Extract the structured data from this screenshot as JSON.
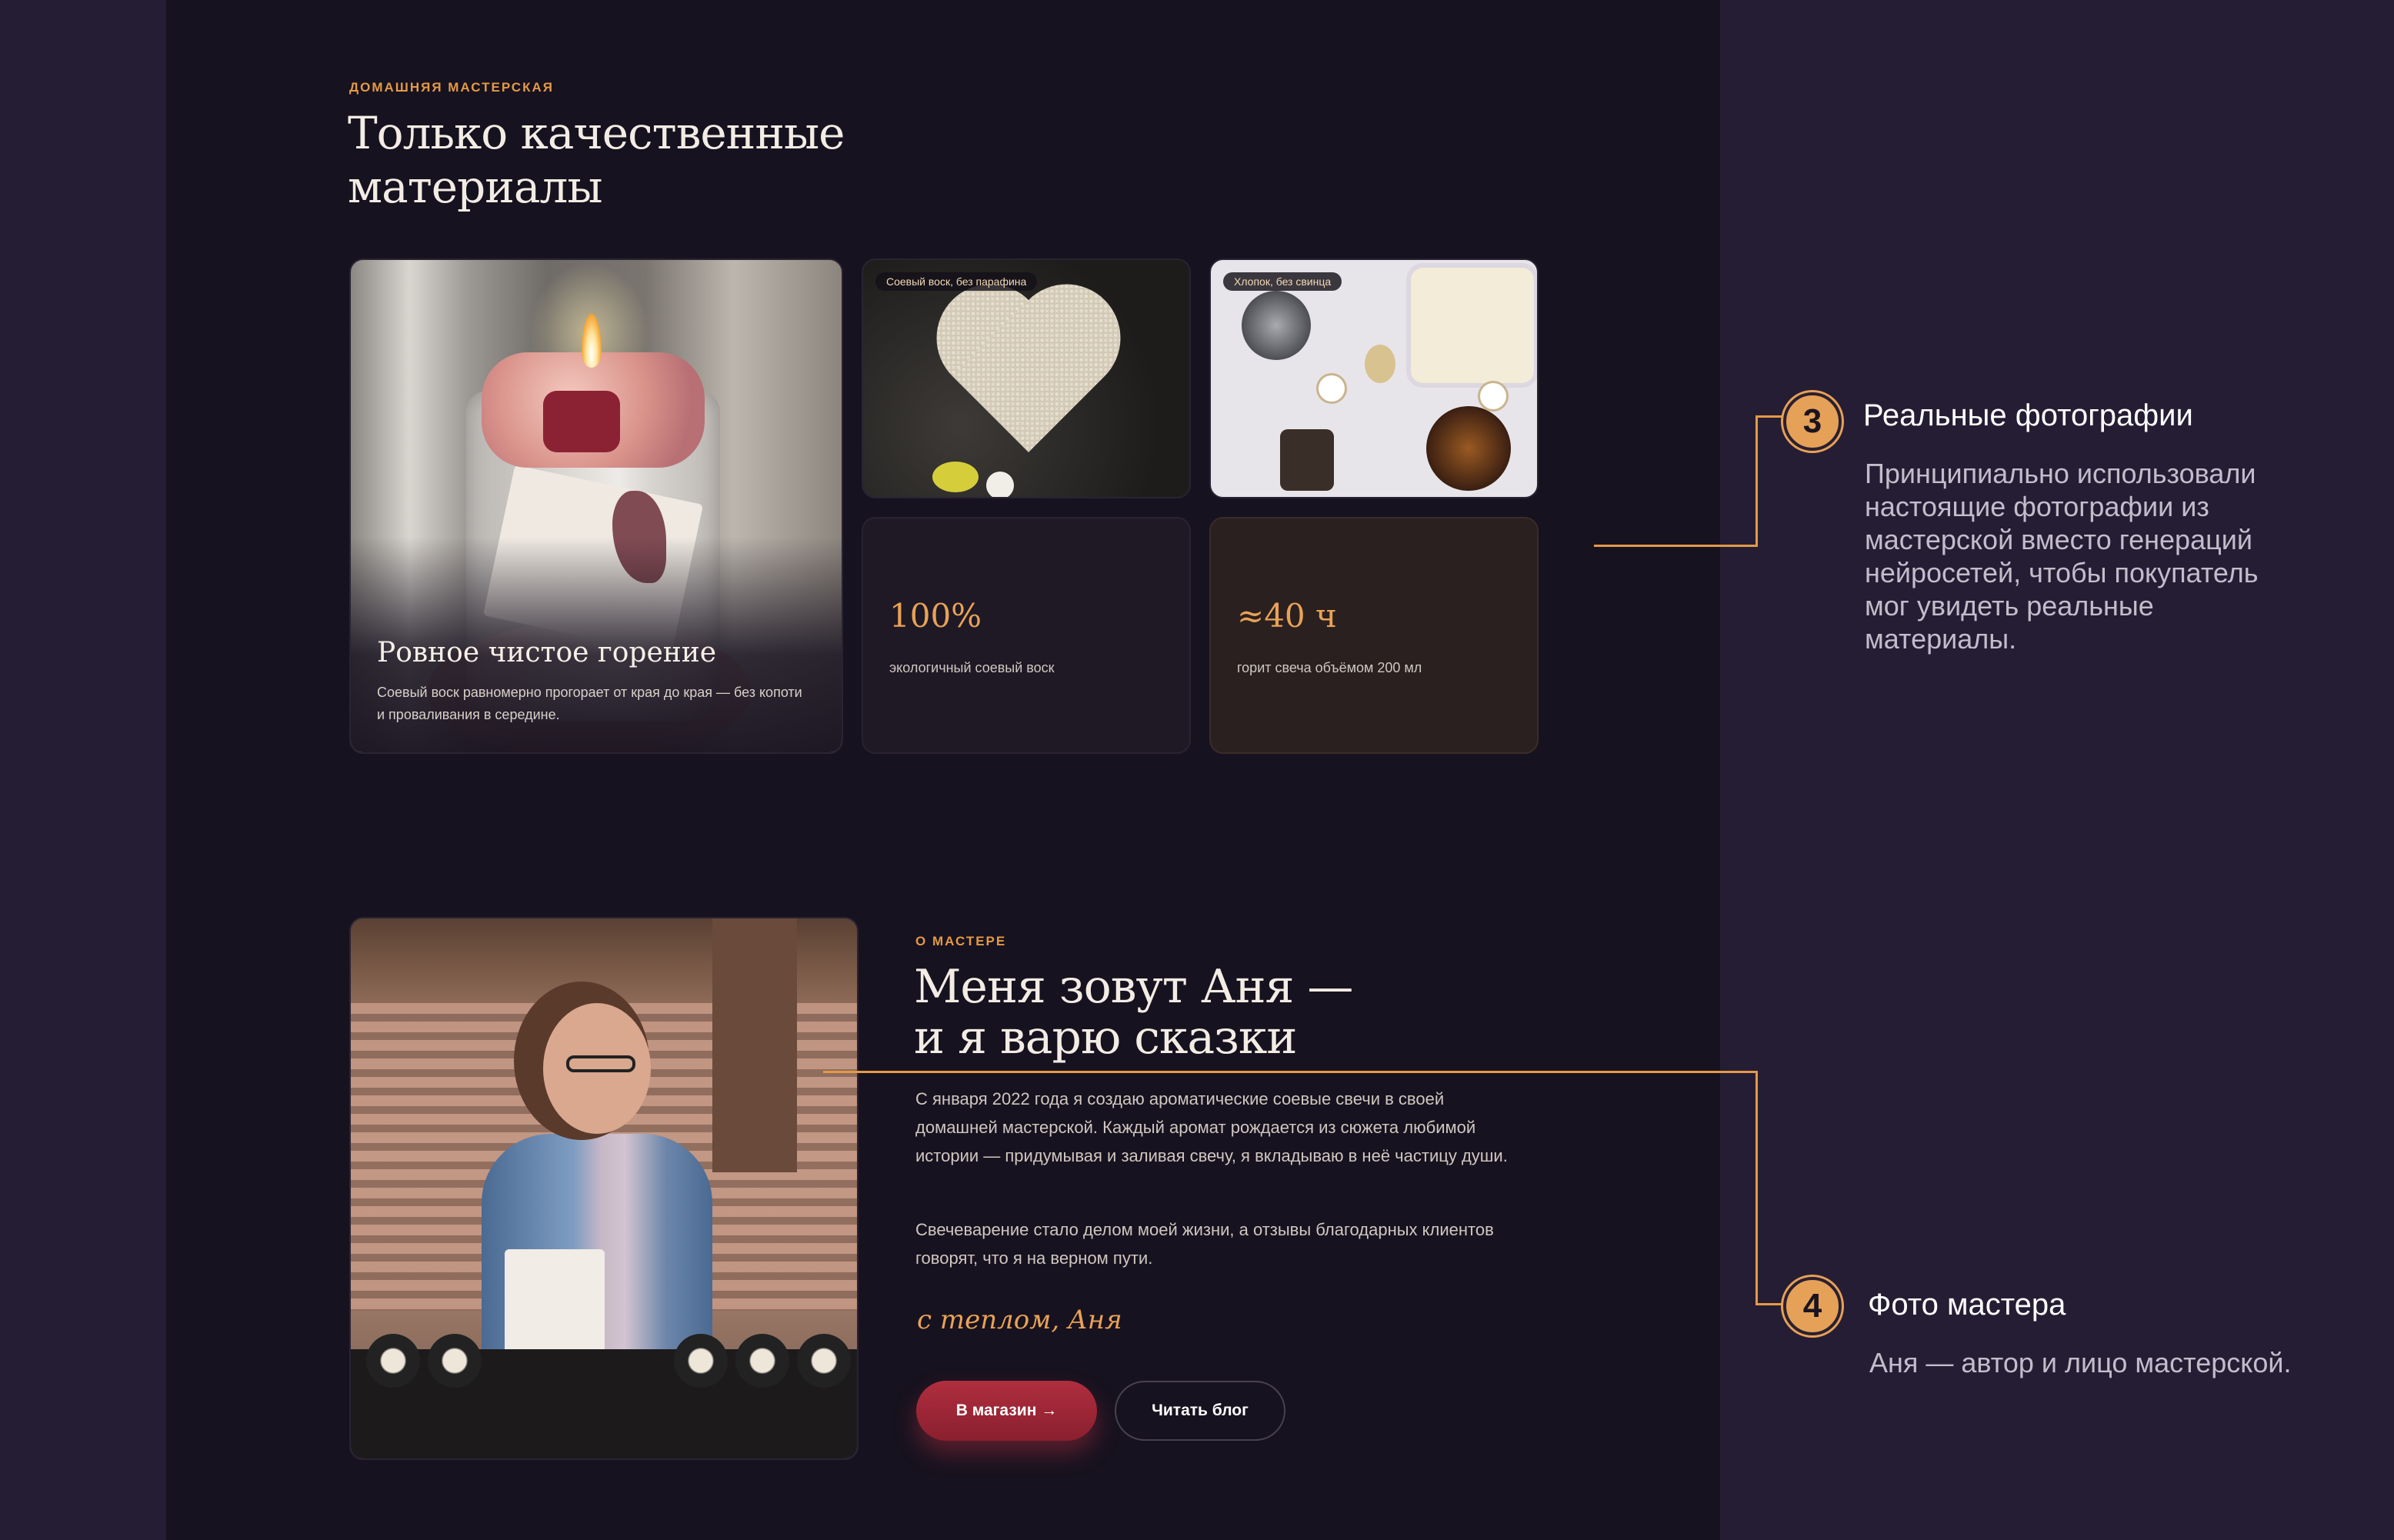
{
  "materials": {
    "eyebrow": "ДОМАШНЯЯ МАСТЕРСКАЯ",
    "title": "Только качественные\nматериалы",
    "feature_card": {
      "title": "Ровное чистое горение",
      "description": "Соевый воск равномерно прогорает от края до края — без копоти и проваливания в середине."
    },
    "photo_tags": [
      "Соевый воск, без парафина",
      "Хлопок, без свинца"
    ],
    "stats": [
      {
        "value": "100%",
        "label": "экологичный соевый воск"
      },
      {
        "value": "≈40 ч",
        "label": "горит свеча объёмом 200 мл"
      }
    ]
  },
  "about": {
    "eyebrow": "О МАСТЕРЕ",
    "title": "Меня зовут Аня —\nи я варю сказки",
    "paragraph1": "С января 2022 года я создаю ароматические соевые свечи в своей домашней мастерской. Каждый аромат рождается из сюжета любимой истории — придумывая и заливая свечу, я вкладываю в неё частицу души.",
    "paragraph2": "Свечеварение стало делом моей жизни, а отзывы благодарных клиентов говорят, что я на верном пути.",
    "signature": "с теплом, Аня",
    "shop_button": "В магазин →",
    "blog_button": "Читать блог"
  },
  "annotations": [
    {
      "number": "3",
      "title": "Реальные фотографии",
      "text": "Принципиально использовали настоящие фотографии из мастерской вместо генераций нейросетей, чтобы покупатель мог увидеть реальные материалы."
    },
    {
      "number": "4",
      "title": "Фото мастера",
      "text": "Аня — автор и лицо мастерской."
    }
  ],
  "colors": {
    "background": "#251d34",
    "panel": "#17121f",
    "accent": "#e39a46",
    "button": "#9b2636"
  }
}
